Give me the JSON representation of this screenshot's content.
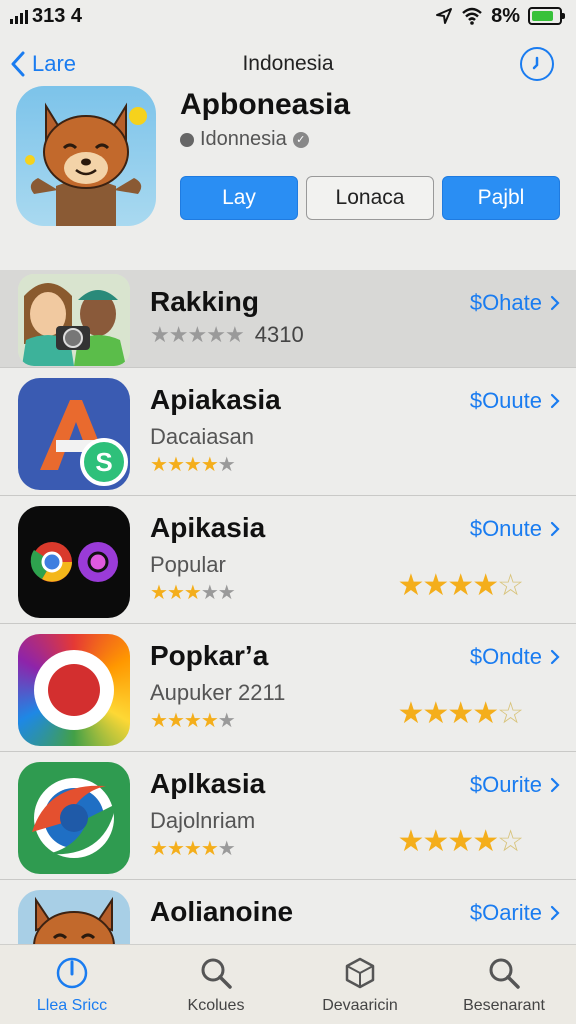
{
  "status": {
    "time": "313 4",
    "battery": "8%",
    "battery_level": 0.8
  },
  "nav": {
    "back_label": "Lare",
    "title": "Indonesia"
  },
  "hero": {
    "title": "Apboneasia",
    "subtitle": "Idonnesia",
    "buttons": [
      "Lay",
      "Lonaca",
      "Pajbl"
    ]
  },
  "rows": [
    {
      "title": "Rakking",
      "subtitle": "",
      "rating_text": "4310",
      "action": "$Ohate",
      "small_stars": 5,
      "small_filled": 0,
      "big_stars": null
    },
    {
      "title": "Apiakasia",
      "subtitle": "Dacaiasan",
      "action": "$Ouute",
      "small_stars": 5,
      "small_filled": 4,
      "big_stars": null
    },
    {
      "title": "Apikasia",
      "subtitle": "Popular",
      "action": "$Onute",
      "small_stars": 5,
      "small_filled": 3,
      "big_stars": 4
    },
    {
      "title": "Popkarʼa",
      "subtitle": "Aupuker 2211",
      "action": "$Ondte",
      "small_stars": 5,
      "small_filled": 4,
      "big_stars": 4
    },
    {
      "title": "Aplkasia",
      "subtitle": "Dajolnriam",
      "action": "$Ourite",
      "small_stars": 5,
      "small_filled": 4,
      "big_stars": 4
    },
    {
      "title": "Aolianoine",
      "subtitle": "",
      "action": "$Oarite",
      "small_stars": 0,
      "small_filled": 0,
      "big_stars": null
    }
  ],
  "tabs": [
    {
      "label": "Llea Sricc",
      "icon": "today-icon",
      "active": true
    },
    {
      "label": "Kcolues",
      "icon": "search-icon",
      "active": false
    },
    {
      "label": "Devaaricin",
      "icon": "box-icon",
      "active": false
    },
    {
      "label": "Besenarant",
      "icon": "search-icon",
      "active": false
    }
  ],
  "colors": {
    "accent": "#1a7cf0",
    "star": "#f4ae1b"
  }
}
